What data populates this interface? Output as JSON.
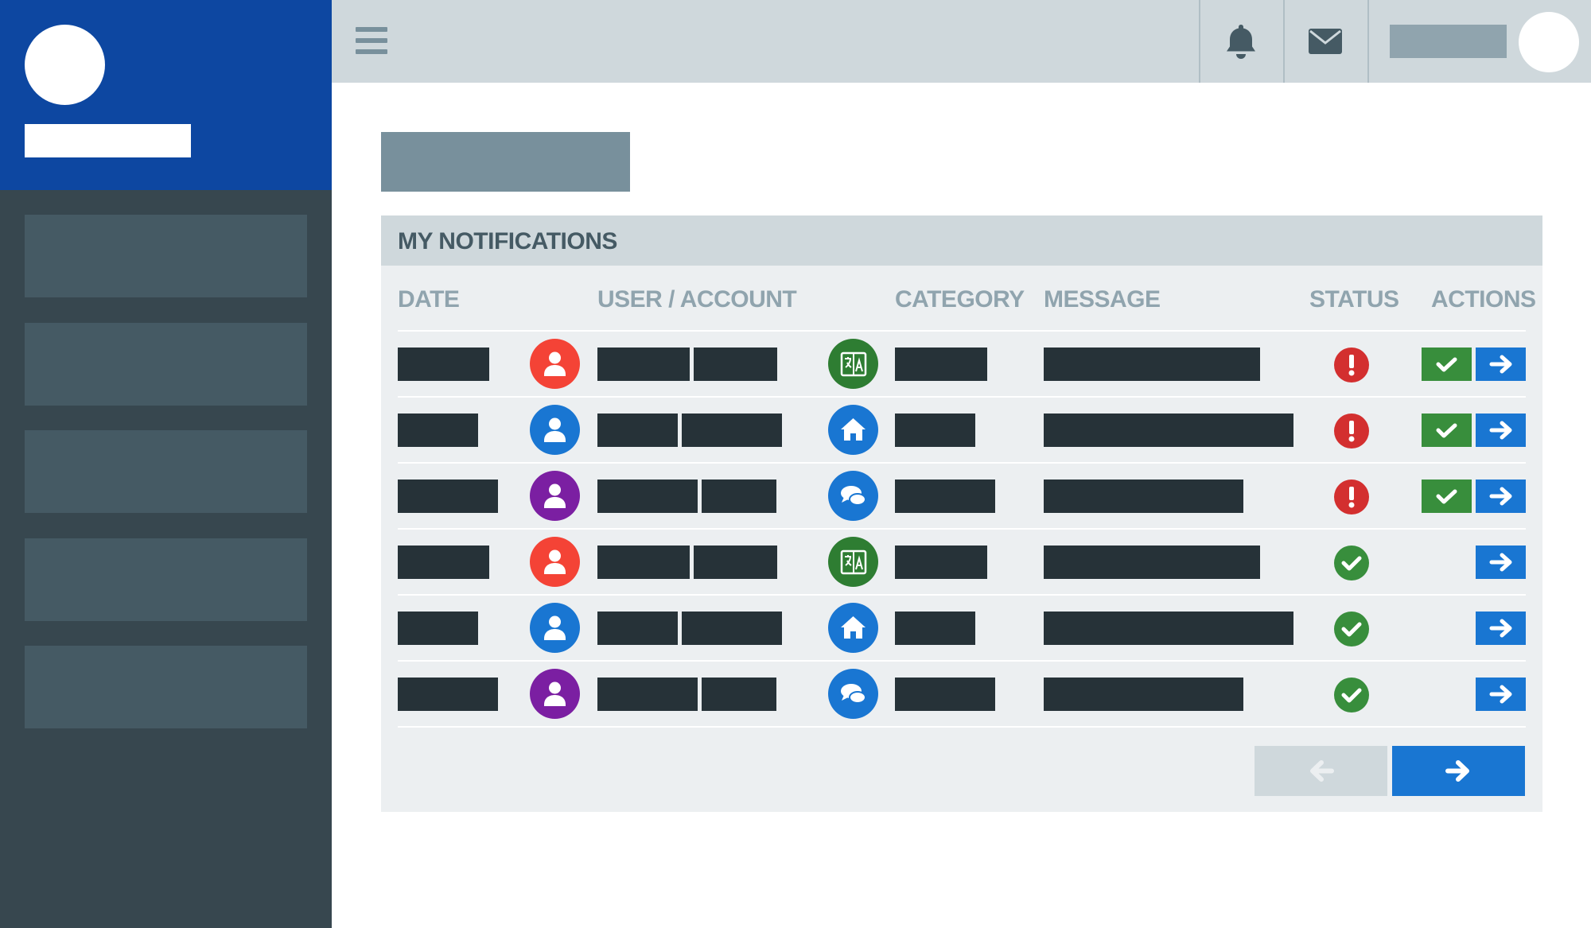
{
  "panel": {
    "title": "MY NOTIFICATIONS",
    "columns": {
      "date": "DATE",
      "user": "USER / ACCOUNT",
      "category": "CATEGORY",
      "message": "MESSAGE",
      "status": "STATUS",
      "actions": "ACTIONS"
    }
  },
  "colors": {
    "brand_blue": "#0d47a1",
    "sidebar": "#37474f",
    "topbar": "#cfd8dc",
    "red": "#f44336",
    "blue": "#1976d2",
    "purple": "#7b1fa2",
    "green": "#2e7d32",
    "alert_red": "#d32f2f",
    "ok_green": "#388e3c"
  },
  "rows": [
    {
      "user_icon": "user-icon",
      "user_color": "red",
      "category_icon": "translate-icon",
      "category_color": "green",
      "status": "alert",
      "has_approve": true
    },
    {
      "user_icon": "user-icon",
      "user_color": "blue",
      "category_icon": "home-icon",
      "category_color": "blue",
      "status": "alert",
      "has_approve": true
    },
    {
      "user_icon": "user-icon",
      "user_color": "purple",
      "category_icon": "chat-icon",
      "category_color": "blue",
      "status": "alert",
      "has_approve": true
    },
    {
      "user_icon": "user-icon",
      "user_color": "red",
      "category_icon": "translate-icon",
      "category_color": "green",
      "status": "ok",
      "has_approve": false
    },
    {
      "user_icon": "user-icon",
      "user_color": "blue",
      "category_icon": "home-icon",
      "category_color": "blue",
      "status": "ok",
      "has_approve": false
    },
    {
      "user_icon": "user-icon",
      "user_color": "purple",
      "category_icon": "chat-icon",
      "category_color": "blue",
      "status": "ok",
      "has_approve": false
    }
  ],
  "pagination": {
    "prev_icon": "arrow-left-icon",
    "prev_enabled": false,
    "next_icon": "arrow-right-icon",
    "next_enabled": true
  }
}
